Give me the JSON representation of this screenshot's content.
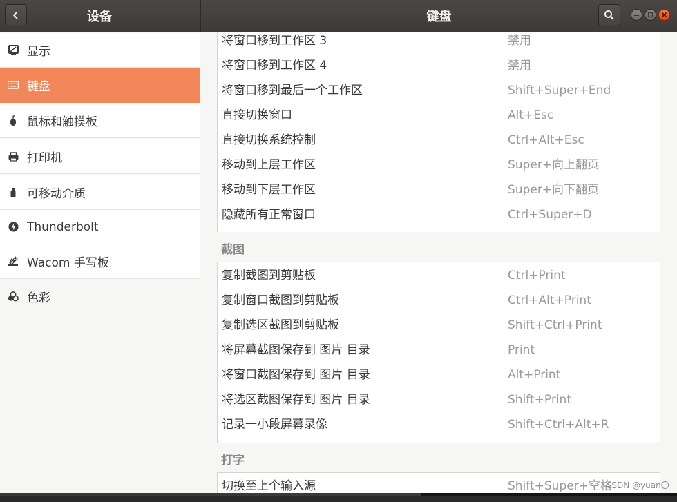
{
  "header": {
    "left_title": "设备",
    "main_title": "键盘"
  },
  "sidebar": {
    "items": [
      {
        "label": "显示",
        "icon": "display-icon"
      },
      {
        "label": "键盘",
        "icon": "keyboard-icon",
        "active": true
      },
      {
        "label": "鼠标和触摸板",
        "icon": "mouse-icon"
      },
      {
        "label": "打印机",
        "icon": "printer-icon"
      },
      {
        "label": "可移动介质",
        "icon": "removable-media-icon"
      },
      {
        "label": "Thunderbolt",
        "icon": "thunderbolt-icon"
      },
      {
        "label": "Wacom 手写板",
        "icon": "wacom-tablet-icon"
      },
      {
        "label": "色彩",
        "icon": "color-icon"
      }
    ]
  },
  "shortcuts_top": [
    {
      "name": "将窗口移到工作区 3",
      "accel": "禁用"
    },
    {
      "name": "将窗口移到工作区 4",
      "accel": "禁用"
    },
    {
      "name": "将窗口移到最后一个工作区",
      "accel": "Shift+Super+End"
    },
    {
      "name": "直接切换窗口",
      "accel": "Alt+Esc"
    },
    {
      "name": "直接切换系统控制",
      "accel": "Ctrl+Alt+Esc"
    },
    {
      "name": "移动到上层工作区",
      "accel": "Super+向上翻页"
    },
    {
      "name": "移动到下层工作区",
      "accel": "Super+向下翻页"
    },
    {
      "name": "隐藏所有正常窗口",
      "accel": "Ctrl+Super+D"
    }
  ],
  "screenshot_section": {
    "title": "截图",
    "rows": [
      {
        "name": "复制截图到剪贴板",
        "accel": "Ctrl+Print"
      },
      {
        "name": "复制窗口截图到剪贴板",
        "accel": "Ctrl+Alt+Print"
      },
      {
        "name": "复制选区截图到剪贴板",
        "accel": "Shift+Ctrl+Print"
      },
      {
        "name": "将屏幕截图保存到 图片 目录",
        "accel": "Print"
      },
      {
        "name": "将窗口截图保存到 图片 目录",
        "accel": "Alt+Print"
      },
      {
        "name": "将选区截图保存到 图片 目录",
        "accel": "Shift+Print"
      },
      {
        "name": "记录一小段屏幕录像",
        "accel": "Shift+Ctrl+Alt+R"
      }
    ]
  },
  "typing_section": {
    "title": "打字",
    "rows": [
      {
        "name": "切换至上个输入源",
        "accel": "Shift+Super+空格"
      }
    ]
  },
  "watermark": "CSDN @yuan〇"
}
